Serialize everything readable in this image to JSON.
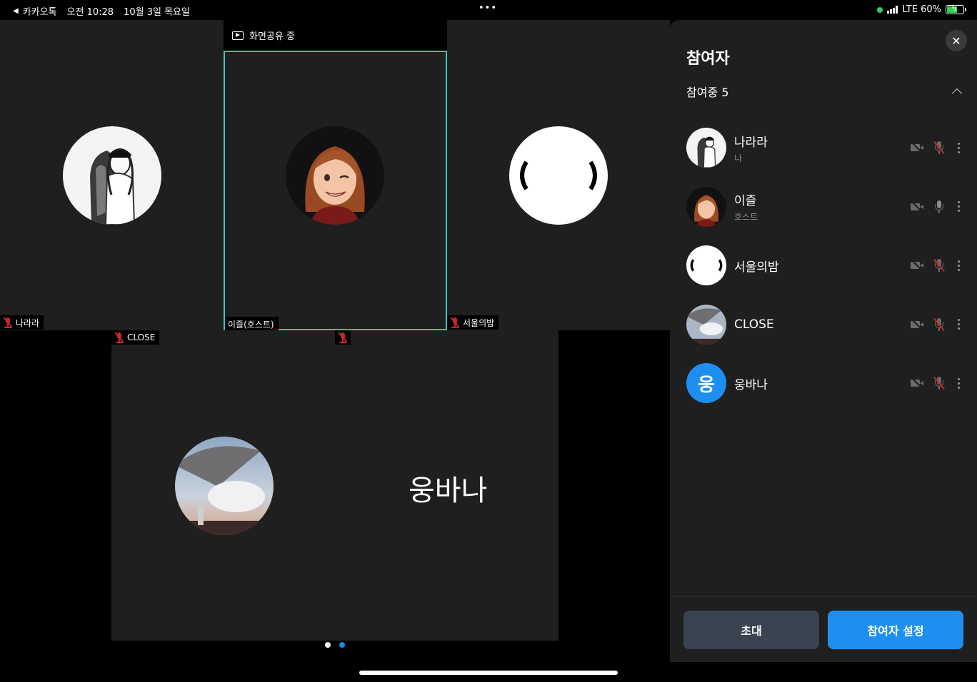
{
  "status_bar": {
    "back_app": "카카오톡",
    "time": "오전 10:28",
    "date": "10월 3일 목요일",
    "network": "LTE 60%"
  },
  "screen_share": {
    "label": "화면공유 중"
  },
  "tiles": [
    {
      "name": "나라라",
      "mic_muted": true
    },
    {
      "name": "이즐(호스트)",
      "mic_muted": false,
      "active_speaker": true
    },
    {
      "name": "서울의밤",
      "mic_muted": true
    },
    {
      "name": "CLOSE",
      "mic_muted": true
    },
    {
      "name": "웅바나",
      "mic_muted": true
    }
  ],
  "pagination": {
    "pages": 2,
    "current": 2
  },
  "panel": {
    "title": "참여자",
    "count_label": "참여중 5",
    "participants": [
      {
        "name": "나라라",
        "role": "나",
        "camera_off": true,
        "mic_muted": true
      },
      {
        "name": "이즐",
        "role": "호스트",
        "camera_off": true,
        "mic_muted": false
      },
      {
        "name": "서울의밤",
        "role": "",
        "camera_off": true,
        "mic_muted": true
      },
      {
        "name": "CLOSE",
        "role": "",
        "camera_off": true,
        "mic_muted": true
      },
      {
        "name": "웅바나",
        "role": "",
        "avatar_letter": "웅",
        "camera_off": true,
        "mic_muted": true
      }
    ],
    "invite_button": "초대",
    "settings_button": "참여자 설정"
  },
  "colors": {
    "accent_blue": "#1e8ff0",
    "speaker_border": "#2fcf7e",
    "mute_red": "#c62828"
  }
}
